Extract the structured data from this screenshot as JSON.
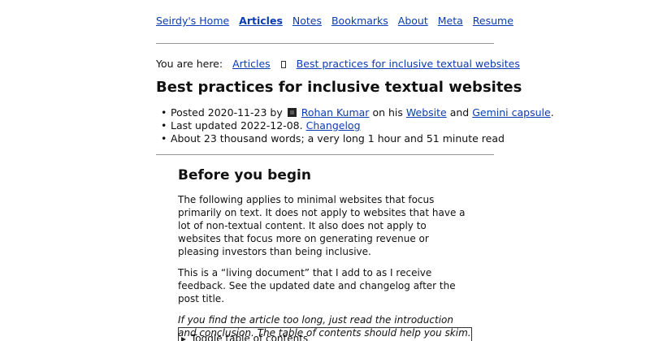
{
  "nav": {
    "items": [
      {
        "label": "Seirdy's Home"
      },
      {
        "label": "Articles"
      },
      {
        "label": "Notes"
      },
      {
        "label": "Bookmarks"
      },
      {
        "label": "About"
      },
      {
        "label": "Meta"
      },
      {
        "label": "Resume"
      }
    ],
    "current_index": 1
  },
  "breadcrumb": {
    "prefix": "You are here:",
    "parent": "Articles",
    "current": "Best practices for inclusive textual websites"
  },
  "article": {
    "title": "Best practices for inclusive textual websites",
    "posted_prefix": "Posted",
    "posted_date": "2020-11-23",
    "by": "by",
    "author": "Rohan Kumar",
    "on_his": "on his",
    "website_link": "Website",
    "and": "and",
    "gemini_link": "Gemini capsule",
    "period": ".",
    "updated_prefix": "Last updated",
    "updated_date": "2022-12-08.",
    "changelog_link": "Changelog",
    "length_text": "About 23 thousand words; a very long 1 hour and 51 minute read"
  },
  "content": {
    "heading": "Before you begin",
    "p1": "The following applies to minimal websites that focus primarily on text. It does not apply to websites that have a lot of non-textual content. It also does not apply to websites that focus more on generating revenue or pleasing investors than being inclusive.",
    "p2": "This is a “living document” that I add to as I receive feedback. See the updated date and changelog after the post title.",
    "p3": "If you find the article too long, just read the introduction and conclusion. The table of contents should help you skim.",
    "toc_label": "Toggle table of contents"
  }
}
